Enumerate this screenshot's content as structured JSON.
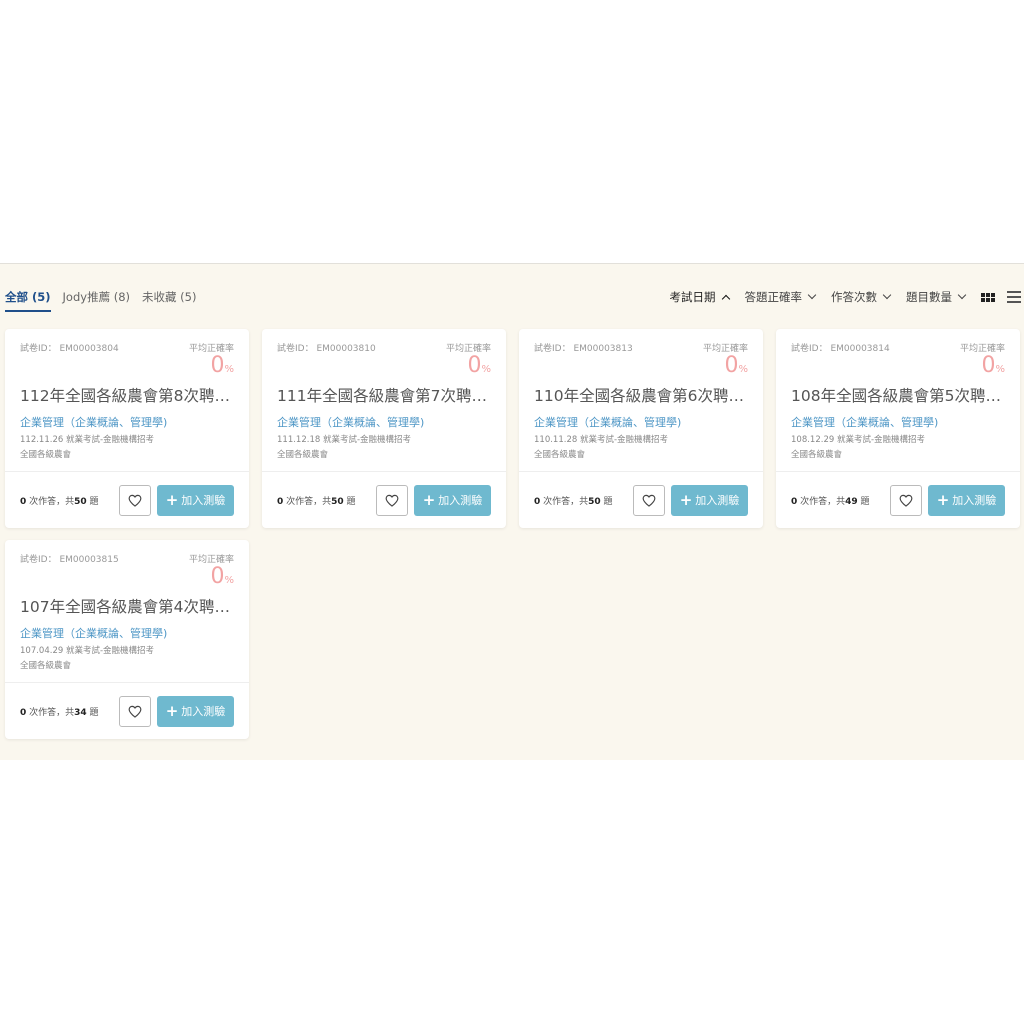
{
  "tabs": [
    {
      "label": "全部 (5)"
    },
    {
      "label": "Jody推薦 (8)"
    },
    {
      "label": "未收藏 (5)"
    }
  ],
  "sorts": [
    {
      "label": "考試日期"
    },
    {
      "label": "答題正確率"
    },
    {
      "label": "作答次數"
    },
    {
      "label": "題目數量"
    }
  ],
  "colors": {
    "accent": "#1f4f8a",
    "button": "#6fb9cf",
    "rate": "#f2a3a3",
    "subject": "#4f97c6",
    "band": "#faf7ee"
  },
  "cards": [
    {
      "id_label": "試卷ID： EM00003804",
      "avg_label": "平均正確率",
      "avg_value": "0",
      "avg_unit": "%",
      "title": "112年全國各級農會第8次聘…",
      "subject": "企業管理（企業概論、管理學)",
      "meta1": "112.11.26 就業考試-金融機構招考",
      "meta2": "全國各級農會",
      "attempts": "0",
      "attempts_label": " 次作答，共",
      "questions": "50",
      "questions_unit": " 題",
      "add_label": "加入測驗"
    },
    {
      "id_label": "試卷ID： EM00003810",
      "avg_label": "平均正確率",
      "avg_value": "0",
      "avg_unit": "%",
      "title": "111年全國各級農會第7次聘…",
      "subject": "企業管理（企業概論、管理學)",
      "meta1": "111.12.18 就業考試-金融機構招考",
      "meta2": "全國各級農會",
      "attempts": "0",
      "attempts_label": " 次作答，共",
      "questions": "50",
      "questions_unit": " 題",
      "add_label": "加入測驗"
    },
    {
      "id_label": "試卷ID： EM00003813",
      "avg_label": "平均正確率",
      "avg_value": "0",
      "avg_unit": "%",
      "title": "110年全國各級農會第6次聘…",
      "subject": "企業管理（企業概論、管理學)",
      "meta1": "110.11.28 就業考試-金融機構招考",
      "meta2": "全國各級農會",
      "attempts": "0",
      "attempts_label": " 次作答，共",
      "questions": "50",
      "questions_unit": " 題",
      "add_label": "加入測驗"
    },
    {
      "id_label": "試卷ID： EM00003814",
      "avg_label": "平均正確率",
      "avg_value": "0",
      "avg_unit": "%",
      "title": "108年全國各級農會第5次聘…",
      "subject": "企業管理（企業概論、管理學)",
      "meta1": "108.12.29 就業考試-金融機構招考",
      "meta2": "全國各級農會",
      "attempts": "0",
      "attempts_label": " 次作答，共",
      "questions": "49",
      "questions_unit": " 題",
      "add_label": "加入測驗"
    },
    {
      "id_label": "試卷ID： EM00003815",
      "avg_label": "平均正確率",
      "avg_value": "0",
      "avg_unit": "%",
      "title": "107年全國各級農會第4次聘…",
      "subject": "企業管理（企業概論、管理學)",
      "meta1": "107.04.29 就業考試-金融機構招考",
      "meta2": "全國各級農會",
      "attempts": "0",
      "attempts_label": " 次作答，共",
      "questions": "34",
      "questions_unit": " 題",
      "add_label": "加入測驗"
    }
  ]
}
